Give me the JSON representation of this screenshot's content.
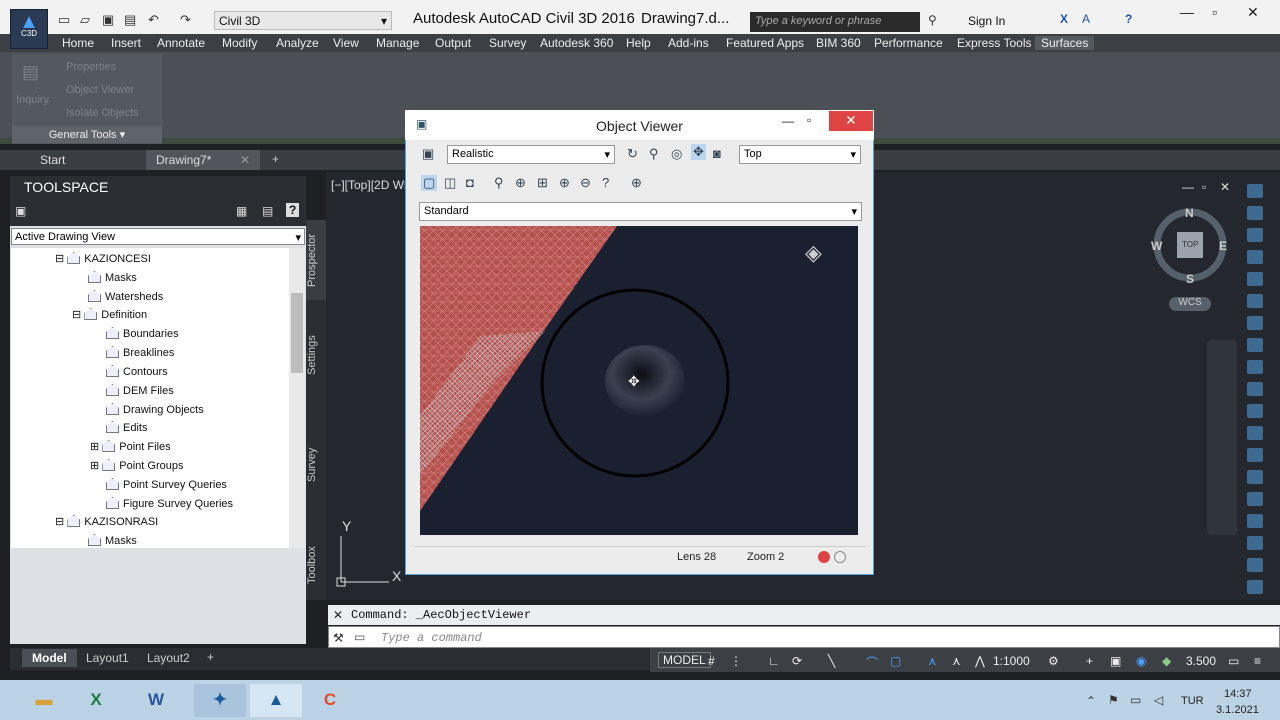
{
  "app": {
    "logo_text": "C3D",
    "workspace": "Civil 3D",
    "title": "Autodesk AutoCAD Civil 3D 2016",
    "document": "Drawing7.d...",
    "search_placeholder": "Type a keyword or phrase",
    "sign_in": "Sign In"
  },
  "menus": [
    "Home",
    "Insert",
    "Annotate",
    "Modify",
    "Analyze",
    "View",
    "Manage",
    "Output",
    "Survey",
    "Autodesk 360",
    "Help",
    "Add-ins",
    "Featured Apps",
    "BIM 360",
    "Performance",
    "Express Tools",
    "Surfaces"
  ],
  "ribbon": {
    "inquiry": "Inquiry",
    "items": [
      "Properties",
      "Object Viewer",
      "Isolate Objects"
    ],
    "panel_title": "General Tools"
  },
  "file_tabs": [
    "Start",
    "Drawing7*"
  ],
  "toolspace": {
    "title": "TOOLSPACE",
    "view_select": "Active Drawing View",
    "tree": [
      "KAZIONCESI",
      "Masks",
      "Watersheds",
      "Definition",
      "Boundaries",
      "Breaklines",
      "Contours",
      "DEM Files",
      "Drawing Objects",
      "Edits",
      "Point Files",
      "Point Groups",
      "Point Survey Queries",
      "Figure Survey Queries",
      "KAZISONRASI",
      "Masks"
    ],
    "vtabs": [
      "Prospector",
      "Settings",
      "Survey",
      "Toolbox"
    ]
  },
  "viewport_label": "[−][Top][2D Wi",
  "object_viewer": {
    "title": "Object Viewer",
    "visual_style": "Realistic",
    "view": "Top",
    "display": "Standard",
    "lens": "Lens 28",
    "zoom": "Zoom 2"
  },
  "viewcube": {
    "top": "TOP",
    "n": "N",
    "s": "S",
    "e": "E",
    "w": "W",
    "wcs": "WCS"
  },
  "ucs": {
    "x": "X",
    "y": "Y"
  },
  "command": {
    "history": "Command: _AecObjectViewer",
    "placeholder": "Type a command"
  },
  "layout_tabs": [
    "Model",
    "Layout1",
    "Layout2"
  ],
  "status": {
    "model": "MODEL",
    "scale": "1:1000",
    "value": "3.500"
  },
  "taskbar": {
    "lang": "TUR",
    "time": "14:37",
    "date": "3.1.2021"
  }
}
